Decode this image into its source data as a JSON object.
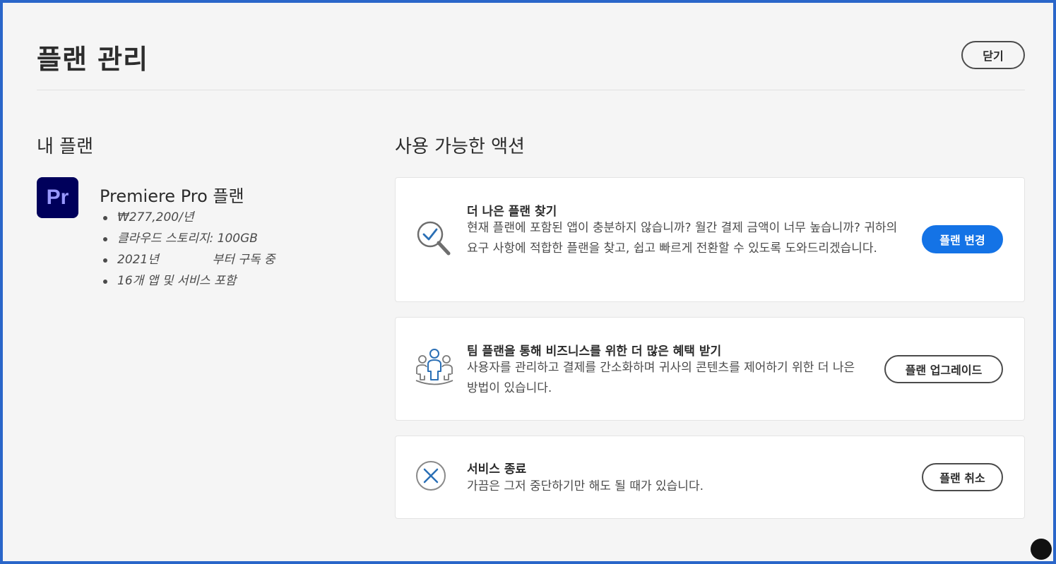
{
  "header": {
    "title": "플랜 관리",
    "close_label": "닫기"
  },
  "my_plan": {
    "section_title": "내 플랜",
    "logo_text": "Pr",
    "plan_name": "Premiere Pro 플랜",
    "details": [
      "₩277,200/년",
      "클라우드 스토리지: 100GB",
      "2021년              부터 구독 중",
      "16개 앱 및 서비스 포함"
    ]
  },
  "actions": {
    "section_title": "사용 가능한 액션",
    "cards": [
      {
        "title": "더 나은 플랜 찾기",
        "description": "현재 플랜에 포함된 앱이 충분하지 않습니까? 월간 결제 금액이 너무 높습니까? 귀하의 요구 사항에 적합한 플랜을 찾고, 쉽고 빠르게 전환할 수 있도록 도와드리겠습니다.",
        "button_label": "플랜 변경",
        "icon": "search-check-icon"
      },
      {
        "title": "팀 플랜을 통해 비즈니스를 위한 더 많은 혜택 받기",
        "description": "사용자를 관리하고 결제를 간소화하며 귀사의 콘텐츠를 제어하기 위한 더 나은 방법이 있습니다.",
        "button_label": "플랜 업그레이드",
        "icon": "team-users-icon"
      },
      {
        "title": "서비스 종료",
        "description": "가끔은 그저 중단하기만 해도 될 때가 있습니다.",
        "button_label": "플랜 취소",
        "icon": "cancel-circle-icon"
      }
    ]
  },
  "colors": {
    "accent": "#1473e6",
    "frame": "#2a66c9",
    "premiere_bg": "#00005b",
    "premiere_text": "#9999ff"
  }
}
